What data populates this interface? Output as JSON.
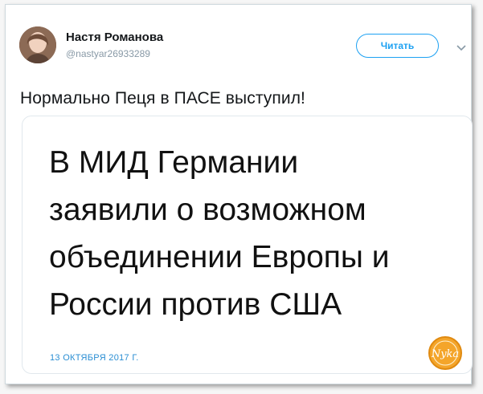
{
  "tweet": {
    "author_name": "Настя Романова",
    "author_handle": "@nastyar26933289",
    "follow_label": "Читать",
    "text": "Нормально Пеця в ПАСЕ выступил!"
  },
  "media": {
    "headline_lines": [
      "В МИД Германии",
      "заявили о возможном",
      "объединении Европы и",
      "России против США"
    ],
    "date": "13 ОКТЯБРЯ 2017 Г."
  },
  "watermark": {
    "text": "Nyka"
  },
  "icons": {
    "avatar": "avatar",
    "more": "chevron-down-icon"
  },
  "colors": {
    "accent": "#1da1f2",
    "date": "#2a8ed3",
    "text": "#14171a",
    "muted": "#8899a6",
    "watermark": "#f0a020"
  }
}
